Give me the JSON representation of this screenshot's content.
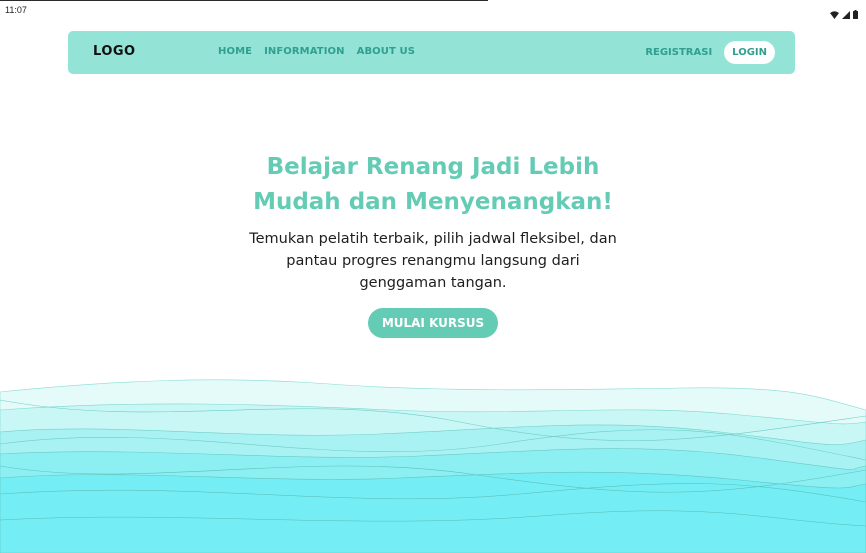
{
  "status_bar": {
    "time": "11:07",
    "icons": [
      "wifi-icon",
      "signal-icon",
      "battery-icon"
    ]
  },
  "navbar": {
    "logo": "LOGO",
    "links": [
      "HOME",
      "INFORMATION",
      "ABOUT US"
    ],
    "register": "REGISTRASI",
    "login": "LOGIN"
  },
  "hero": {
    "title": "Belajar Renang Jadi Lebih Mudah dan Menyenangkan!",
    "subtitle": "Temukan pelatih terbaik, pilih jadwal fleksibel, dan pantau progres renangmu langsung dari genggaman tangan.",
    "cta": "MULAI KURSUS"
  },
  "colors": {
    "accent": "#64cbb5",
    "navbar_bg": "#93e3d6",
    "nav_text": "#2f9f90",
    "wave_light": "#dffaf9",
    "wave_dark": "#66eef4"
  }
}
